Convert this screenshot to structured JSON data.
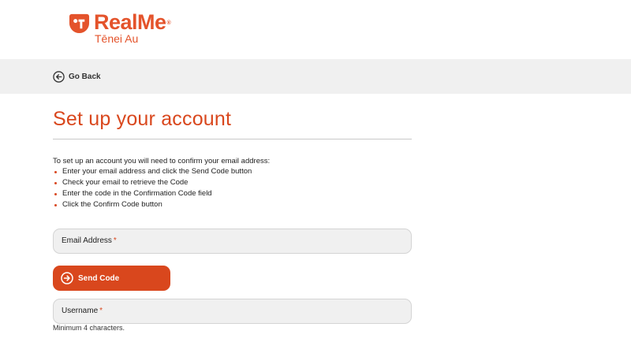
{
  "brand": {
    "name": "RealMe",
    "registered": "®",
    "subtitle": "Tēnei Au",
    "color": "#e4532b"
  },
  "nav": {
    "back_label": "Go Back",
    "back_icon": "arrow-left-circle-icon"
  },
  "page": {
    "title": "Set up your account",
    "intro": "To set up an account you will need to confirm your email address:",
    "steps": [
      "Enter your email address and click the Send Code button",
      "Check your email to retrieve the Code",
      "Enter the code in the Confirmation Code field",
      "Click the Confirm Code button"
    ]
  },
  "form": {
    "email": {
      "label": "Email Address",
      "required_mark": "*",
      "value": ""
    },
    "send_code": {
      "label": "Send Code",
      "icon": "arrow-right-circle-icon"
    },
    "username": {
      "label": "Username",
      "required_mark": "*",
      "value": "",
      "hint": "Minimum 4 characters."
    }
  },
  "colors": {
    "accent": "#d9471d",
    "nav_bg": "#f0f0f0",
    "field_bg": "#f0f0f0"
  }
}
